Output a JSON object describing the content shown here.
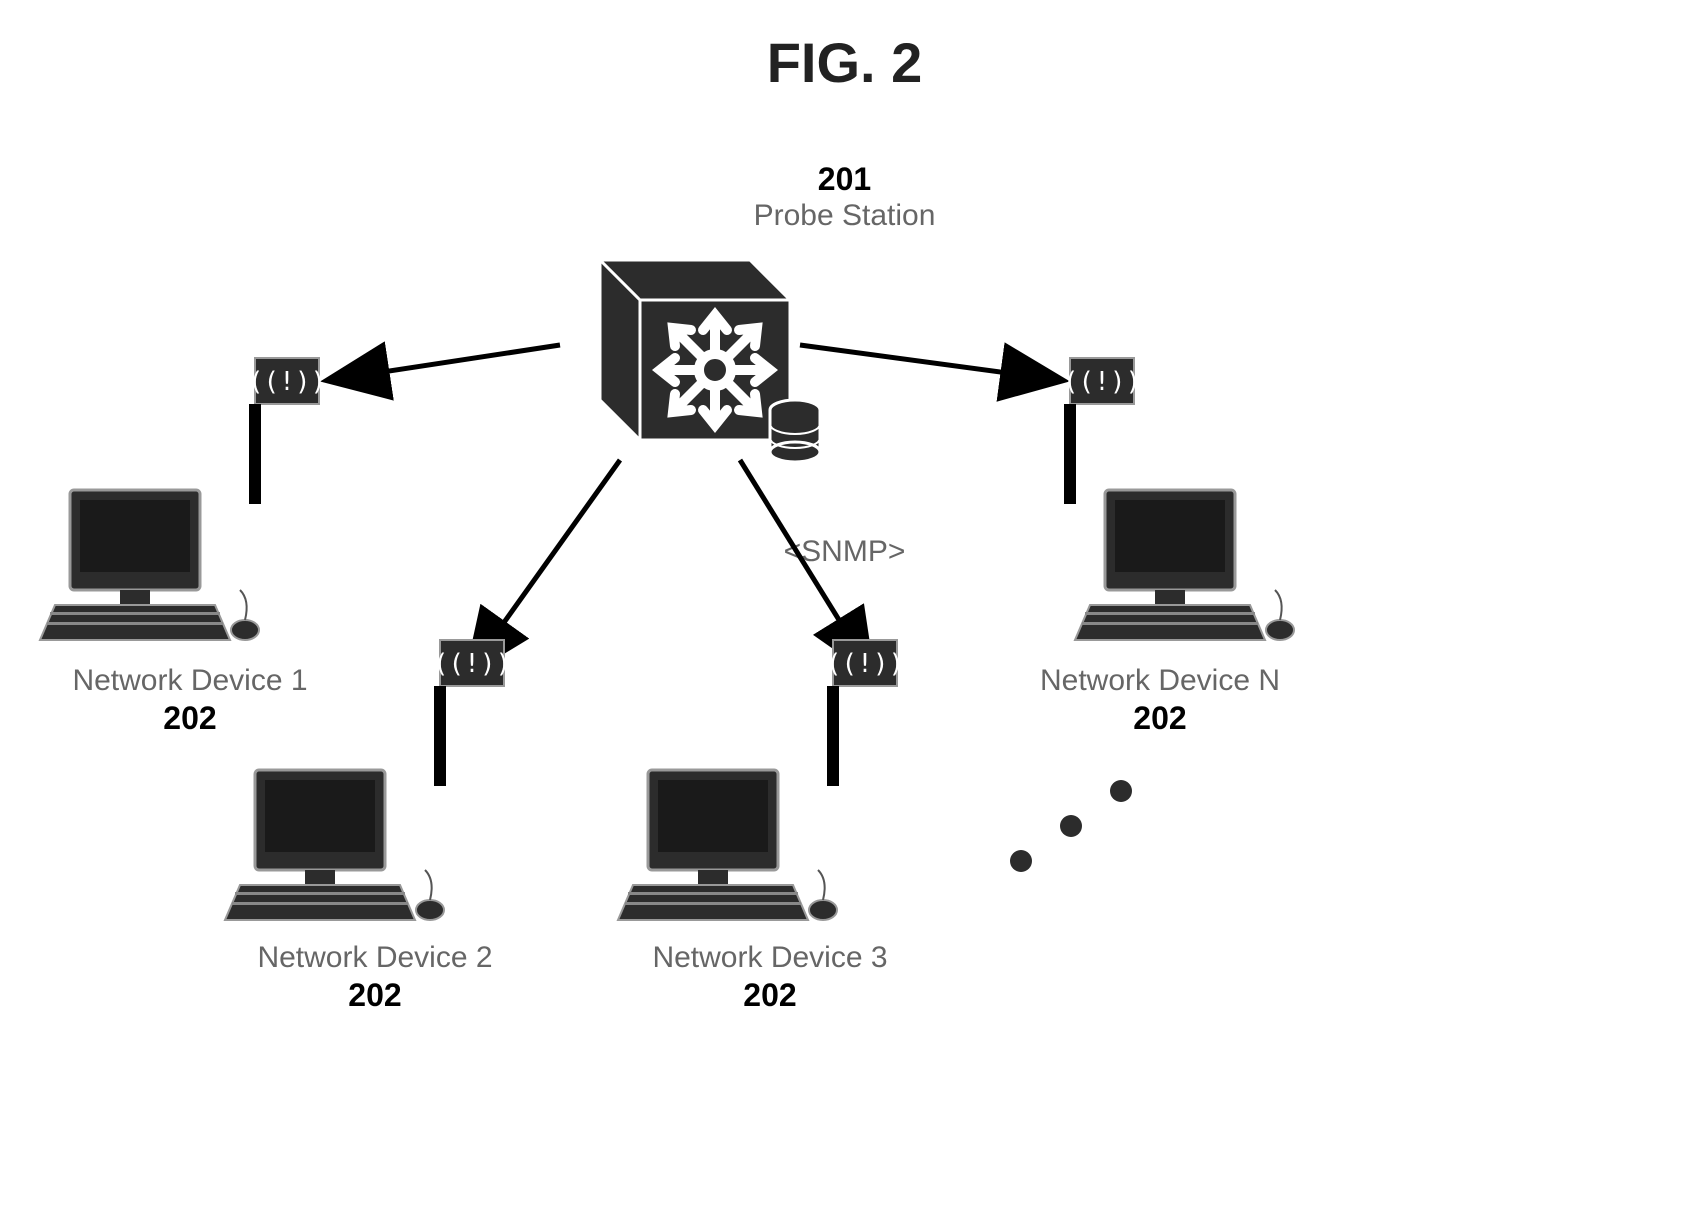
{
  "figure_title": "FIG. 2",
  "probe": {
    "ref": "201",
    "name": "Probe Station"
  },
  "protocol_label": "<SNMP>",
  "devices": [
    {
      "name": "Network Device 1",
      "ref": "202"
    },
    {
      "name": "Network Device 2",
      "ref": "202"
    },
    {
      "name": "Network Device 3",
      "ref": "202"
    },
    {
      "name": "Network Device N",
      "ref": "202"
    }
  ]
}
